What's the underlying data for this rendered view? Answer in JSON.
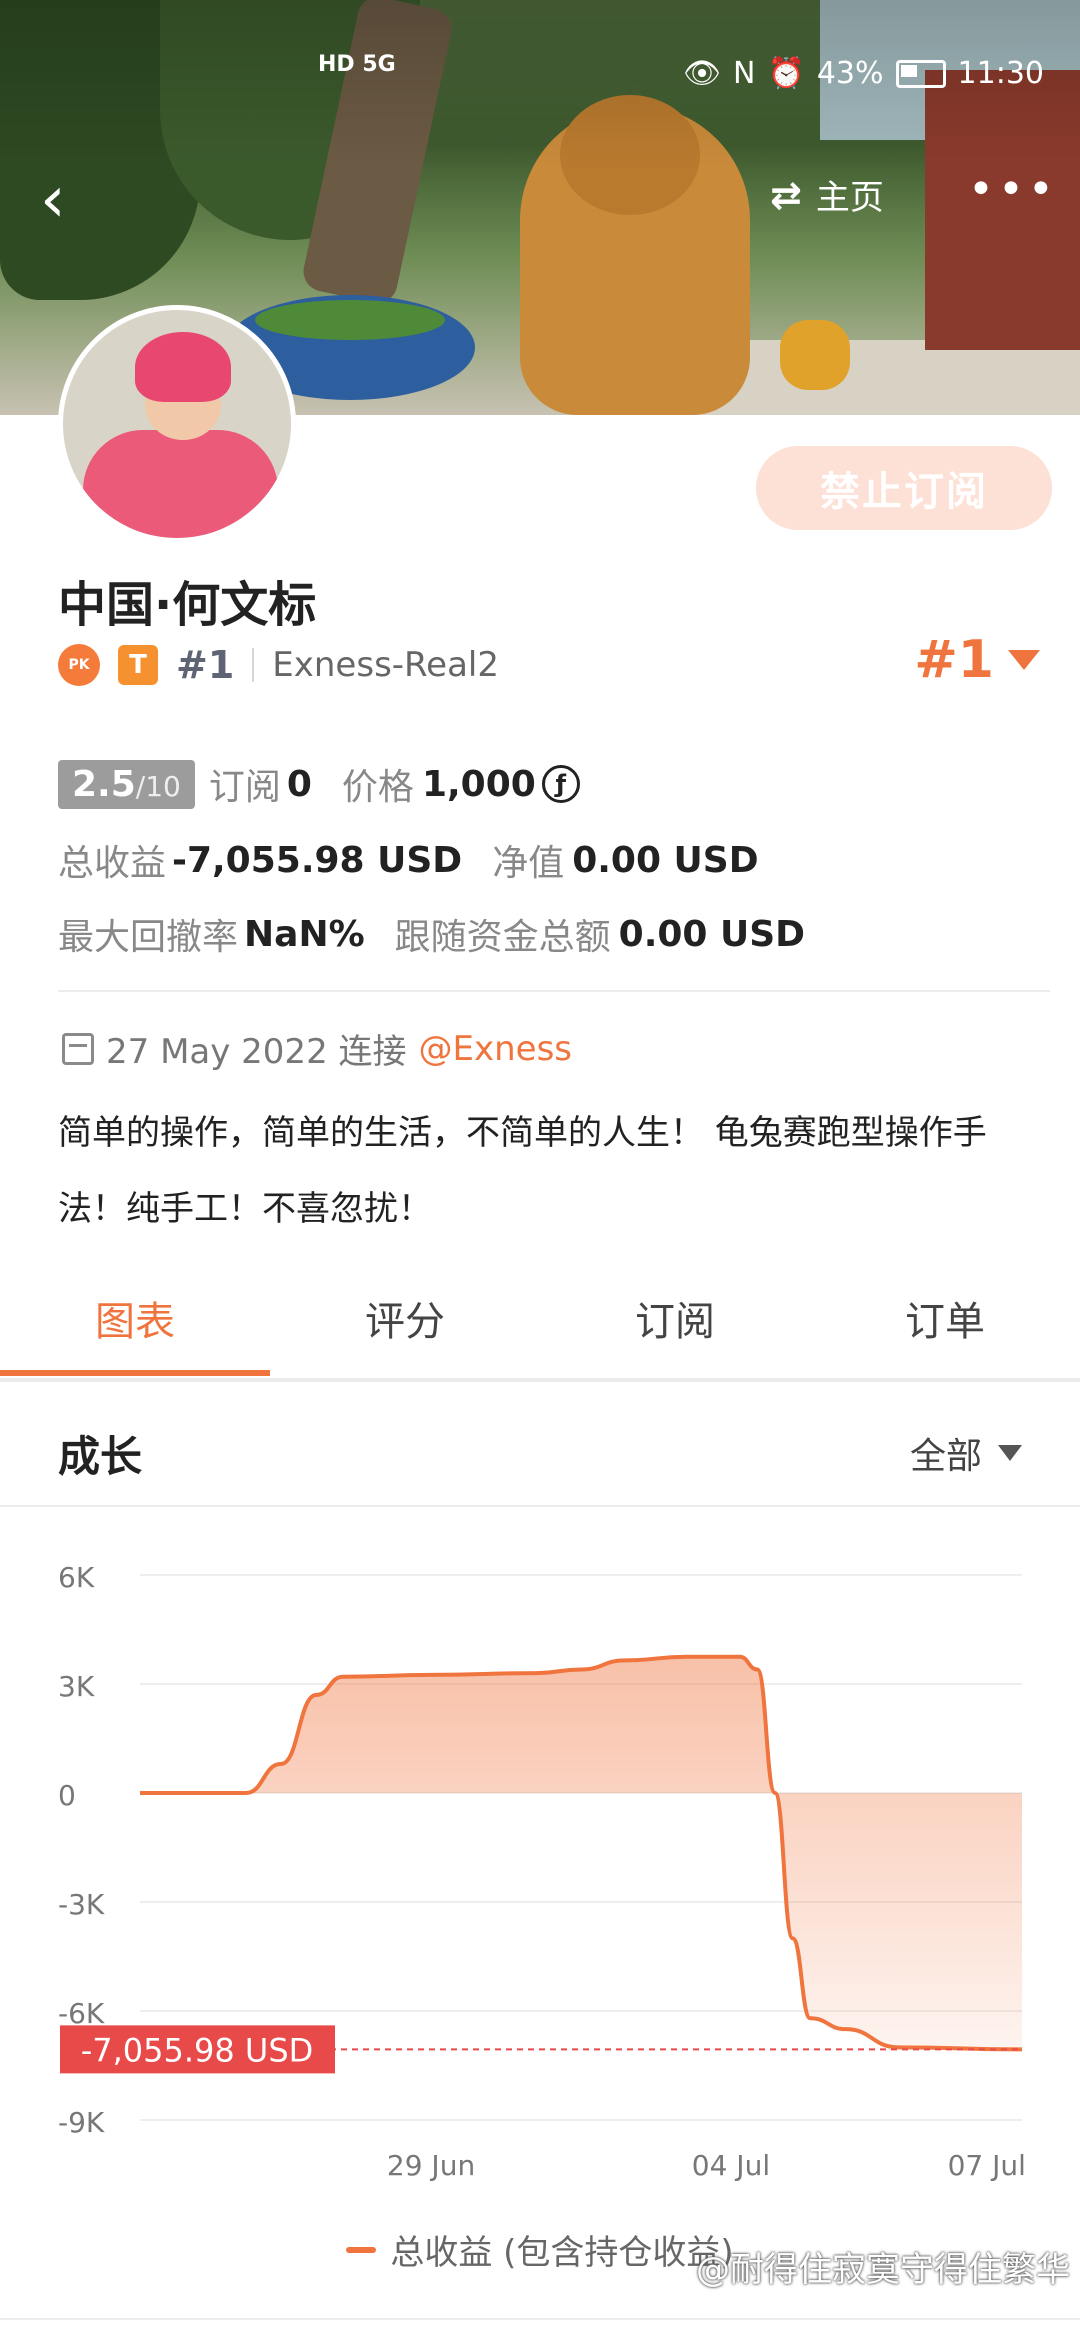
{
  "status_bar": {
    "network": "HD 5G",
    "battery": "43%",
    "time": "11:30"
  },
  "nav": {
    "back_icon": "chevron-left-icon",
    "home_label": "主页",
    "more_icon": "more-dots-icon"
  },
  "profile": {
    "name": "中国·何文标",
    "rank_small": "#1",
    "account": "Exness-Real2",
    "rank_big": "#1",
    "unsubscribe_label": "禁止订阅"
  },
  "stats": {
    "score": "2.5",
    "score_total": "/10",
    "subscribe_label": "订阅",
    "subscribe_value": "0",
    "price_label": "价格",
    "price_value": "1,000",
    "profit_label": "总收益",
    "profit_value": "-7,055.98 USD",
    "equity_label": "净值",
    "equity_value": "0.00 USD",
    "drawdown_label": "最大回撤率",
    "drawdown_value": "NaN%",
    "follow_label": "跟随资金总额",
    "follow_value": "0.00 USD"
  },
  "connection": {
    "date": "27 May 2022 连接",
    "broker": "@Exness"
  },
  "bio": "简单的操作，简单的生活，不简单的人生！ 龟兔赛跑型操作手法！纯手工！不喜忽扰！",
  "tabs": [
    "图表",
    "评分",
    "订阅",
    "订单"
  ],
  "section": {
    "title": "成长",
    "filter": "全部"
  },
  "colors": {
    "accent": "#f0743e",
    "marker": "#e84a4a"
  },
  "chart_data": {
    "type": "area",
    "title": "",
    "xlabel": "",
    "ylabel": "",
    "y_ticks": [
      "6K",
      "3K",
      "0",
      "-3K",
      "-6K",
      "-9K"
    ],
    "x_ticks": [
      "29 Jun",
      "04 Jul",
      "07 Jul"
    ],
    "ylim": [
      -9000,
      6000
    ],
    "series": [
      {
        "name": "总收益 (包含持仓收益)",
        "points": [
          [
            0,
            0
          ],
          [
            0.12,
            0
          ],
          [
            0.16,
            800
          ],
          [
            0.2,
            2700
          ],
          [
            0.23,
            3200
          ],
          [
            0.33,
            3250
          ],
          [
            0.45,
            3300
          ],
          [
            0.5,
            3400
          ],
          [
            0.55,
            3650
          ],
          [
            0.62,
            3750
          ],
          [
            0.68,
            3750
          ],
          [
            0.7,
            3400
          ],
          [
            0.72,
            0
          ],
          [
            0.74,
            -4000
          ],
          [
            0.76,
            -6200
          ],
          [
            0.8,
            -6500
          ],
          [
            0.86,
            -7000
          ],
          [
            1.0,
            -7055.98
          ]
        ]
      }
    ],
    "marker_label": "-7,055.98 USD",
    "marker_value": -7055.98
  },
  "legend_label": "总收益 (包含持仓收益)",
  "watermark": "@耐得住寂寞守得住繁华"
}
